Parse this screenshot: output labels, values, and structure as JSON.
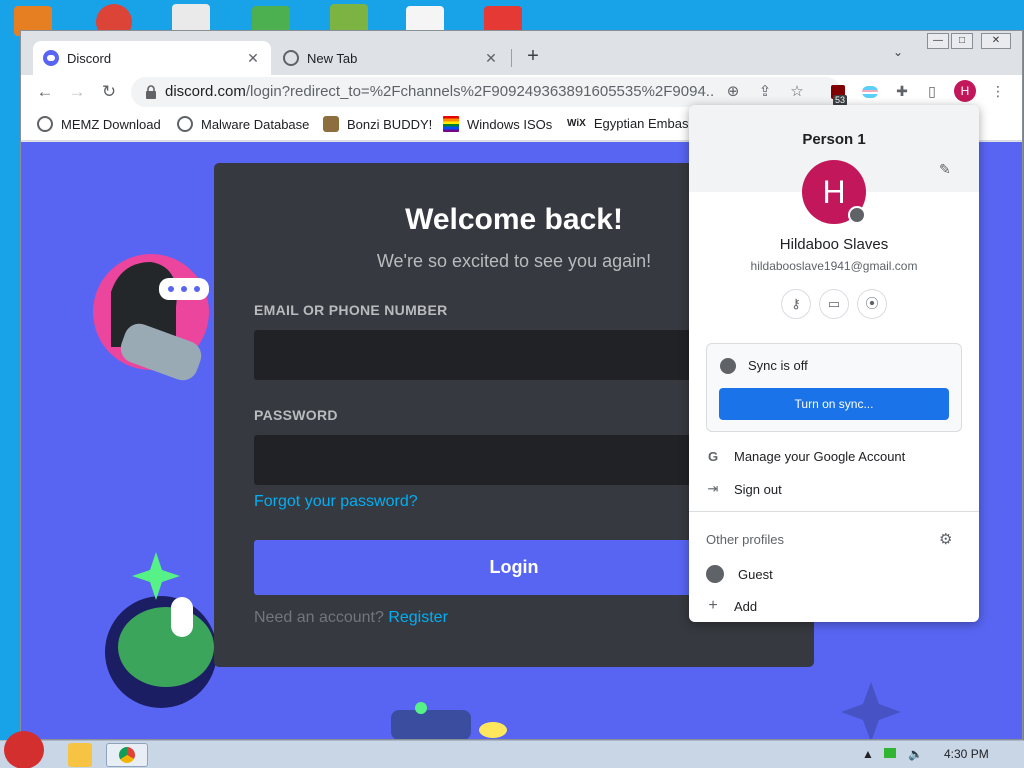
{
  "browser": {
    "tabs": [
      {
        "label": "Discord",
        "active": true
      },
      {
        "label": "New Tab",
        "active": false
      }
    ],
    "new_tab_symbol": "+",
    "url_host": "discord.com",
    "url_path": "/login?redirect_to=%2Fchannels%2F909249363891605535%2F9094...",
    "extension_badge": "53",
    "avatar_letter": "H",
    "bookmarks": [
      "MEMZ Download",
      "Malware Database",
      "Bonzi BUDDY!",
      "Windows ISOs",
      "Egyptian Embassy"
    ],
    "bookmark_wix_label": "WiX"
  },
  "discord": {
    "welcome": "Welcome back!",
    "subtitle": "We're so excited to see you again!",
    "email_label": "EMAIL OR PHONE NUMBER",
    "email_value": "",
    "password_label": "PASSWORD",
    "password_value": "",
    "forgot": "Forgot your password?",
    "login_button": "Login",
    "need_account": "Need an account?",
    "register": "Register",
    "accent": "#5865f2"
  },
  "profile_popup": {
    "title": "Person 1",
    "avatar_letter": "H",
    "name": "Hildaboo Slaves",
    "email": "hildabooslave1941@gmail.com",
    "sync_status": "Sync is off",
    "sync_button": "Turn on sync...",
    "manage_account": "Manage your Google Account",
    "sign_out": "Sign out",
    "other_profiles": "Other profiles",
    "guest": "Guest",
    "add": "Add",
    "accent": "#1a73e8",
    "avatar_color": "#c2185b"
  },
  "taskbar": {
    "clock": "4:30 PM"
  }
}
